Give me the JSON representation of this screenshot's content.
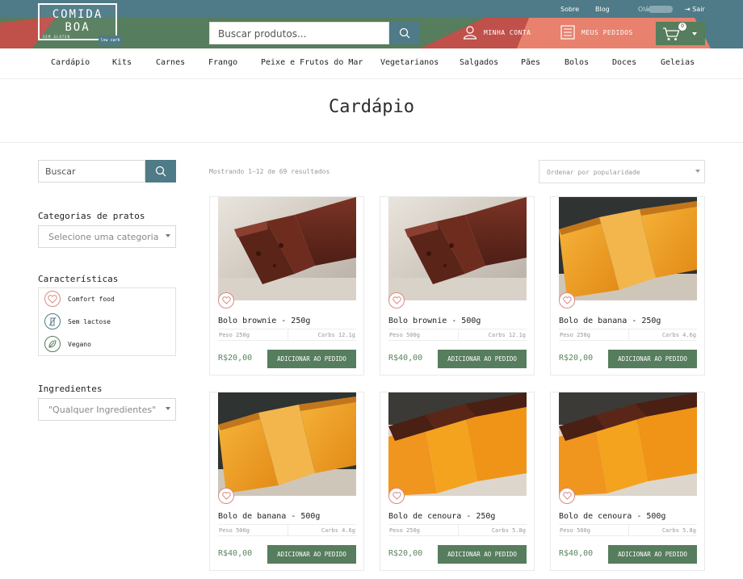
{
  "brand": {
    "line1": "COMIDA",
    "line2": "BOA",
    "tagline": "SEM GLÚTEN",
    "badge": "low carb"
  },
  "top_links": {
    "about": "Sobre",
    "blog": "Blog",
    "greeting": "Olá",
    "logout": "Sair"
  },
  "header": {
    "search_placeholder": "Buscar produtos...",
    "account_label": "MINHA CONTA",
    "orders_label": "MEUS PEDIDOS",
    "cart_count": "0"
  },
  "nav": [
    "Cardápio",
    "Kits",
    "Carnes",
    "Frango",
    "Peixe e Frutos do Mar",
    "Vegetarianos",
    "Salgados",
    "Pães",
    "Bolos",
    "Doces",
    "Geleias"
  ],
  "page_title": "Cardápio",
  "sidebar": {
    "search_placeholder": "Buscar",
    "categories_heading": "Categorias de pratos",
    "categories_select": "Selecione uma categoria",
    "features_heading": "Características",
    "features": [
      {
        "label": "Comfort food",
        "icon": "heart-icon",
        "color": "#d98a83"
      },
      {
        "label": "Sem lactose",
        "icon": "bottle-crossed-icon",
        "color": "#4f7a87"
      },
      {
        "label": "Vegano",
        "icon": "leaf-icon",
        "color": "#567d5d"
      }
    ],
    "ingredients_heading": "Ingredientes",
    "ingredients_select": "\"Qualquer Ingredientes\""
  },
  "results": {
    "count_text": "Mostrando 1–12 de 69 resultados",
    "order_select": "Ordenar por popularidade"
  },
  "add_label": "ADICIONAR AO PEDIDO",
  "products": [
    {
      "name": "Bolo brownie - 250g",
      "weight": "Peso 250g",
      "carbs": "Carbs 12.1g",
      "price": "R$20,00",
      "image": "brownie"
    },
    {
      "name": "Bolo brownie - 500g",
      "weight": "Peso 500g",
      "carbs": "Carbs 12.1g",
      "price": "R$40,00",
      "image": "brownie"
    },
    {
      "name": "Bolo de banana - 250g",
      "weight": "Peso 250g",
      "carbs": "Carbs 4.6g",
      "price": "R$20,00",
      "image": "banana"
    },
    {
      "name": "Bolo de banana - 500g",
      "weight": "Peso 500g",
      "carbs": "Carbs 4.6g",
      "price": "R$40,00",
      "image": "banana"
    },
    {
      "name": "Bolo de cenoura - 250g",
      "weight": "Peso 250g",
      "carbs": "Carbs 5.8g",
      "price": "R$20,00",
      "image": "carrot"
    },
    {
      "name": "Bolo de cenoura - 500g",
      "weight": "Peso 500g",
      "carbs": "Carbs 5.8g",
      "price": "R$40,00",
      "image": "carrot"
    }
  ],
  "colors": {
    "teal": "#4f7a87",
    "green": "#567d5d",
    "coral": "#e8816d",
    "accent_red": "#d98a83"
  }
}
